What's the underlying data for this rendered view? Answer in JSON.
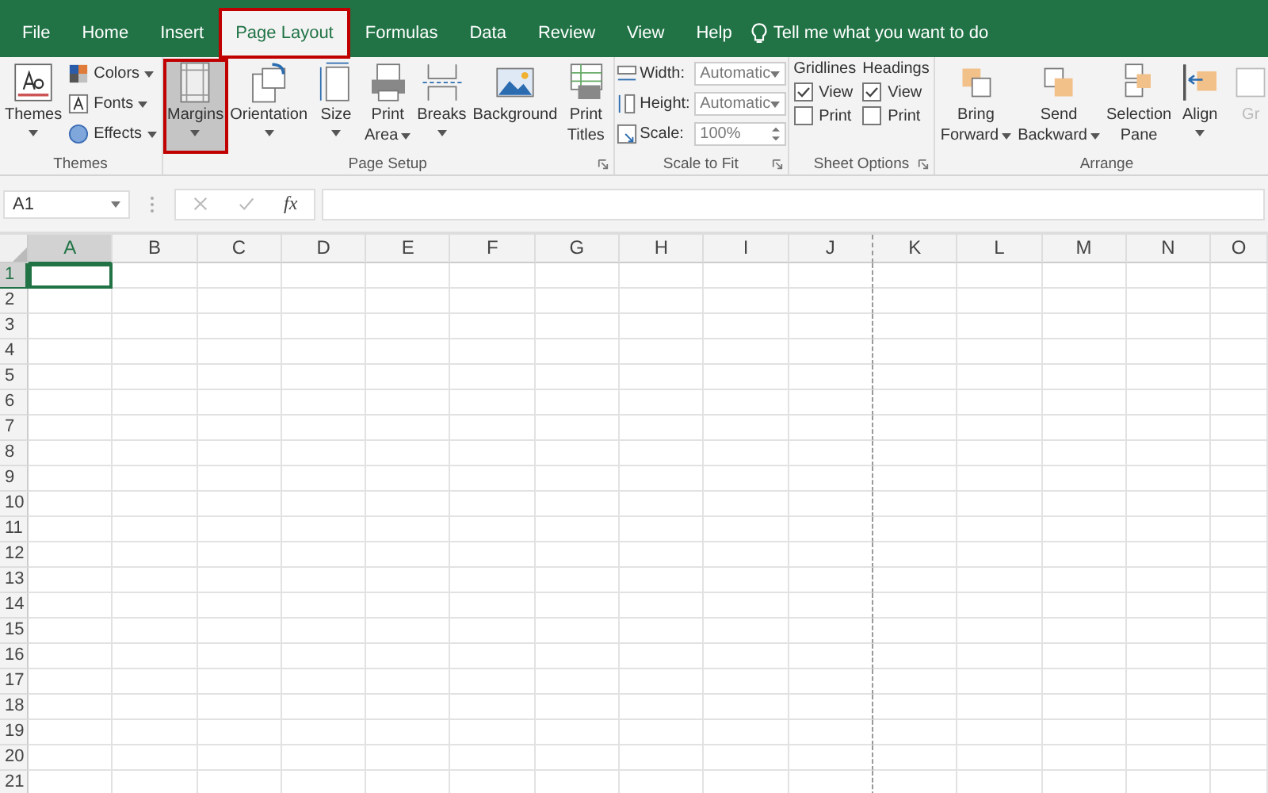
{
  "tabs": [
    {
      "label": "File",
      "selected": false,
      "highlighted": false
    },
    {
      "label": "Home",
      "selected": false,
      "highlighted": false
    },
    {
      "label": "Insert",
      "selected": false,
      "highlighted": false
    },
    {
      "label": "Page Layout",
      "selected": true,
      "highlighted": true
    },
    {
      "label": "Formulas",
      "selected": false,
      "highlighted": false
    },
    {
      "label": "Data",
      "selected": false,
      "highlighted": false
    },
    {
      "label": "Review",
      "selected": false,
      "highlighted": false
    },
    {
      "label": "View",
      "selected": false,
      "highlighted": false
    },
    {
      "label": "Help",
      "selected": false,
      "highlighted": false
    }
  ],
  "tell_me": {
    "placeholder": "Tell me what you want to do"
  },
  "ribbon": [
    {
      "label": "Themes",
      "launcher": false,
      "items": [
        {
          "kind": "large",
          "lines": [
            "Themes"
          ],
          "dropdown": true,
          "highlighted": false,
          "disabled": false
        },
        {
          "kind": "stack",
          "entries": [
            {
              "label": "Colors",
              "dropdown": true
            },
            {
              "label": "Fonts",
              "dropdown": true
            },
            {
              "label": "Effects",
              "dropdown": true
            }
          ]
        }
      ]
    },
    {
      "label": "Page Setup",
      "launcher": true,
      "items": [
        {
          "kind": "large",
          "lines": [
            "Margins"
          ],
          "dropdown": true,
          "highlighted": true,
          "disabled": false
        },
        {
          "kind": "large",
          "lines": [
            "Orientation"
          ],
          "dropdown": true,
          "highlighted": false,
          "disabled": false
        },
        {
          "kind": "large",
          "lines": [
            "Size"
          ],
          "dropdown": true,
          "highlighted": false,
          "disabled": false
        },
        {
          "kind": "large",
          "lines": [
            "Print",
            "Area"
          ],
          "dropdown": true,
          "highlighted": false,
          "disabled": false
        },
        {
          "kind": "large",
          "lines": [
            "Breaks"
          ],
          "dropdown": true,
          "highlighted": false,
          "disabled": false
        },
        {
          "kind": "large",
          "lines": [
            "Background"
          ],
          "dropdown": false,
          "highlighted": false,
          "disabled": false
        },
        {
          "kind": "large",
          "lines": [
            "Print",
            "Titles"
          ],
          "dropdown": false,
          "highlighted": false,
          "disabled": false
        }
      ]
    },
    {
      "label": "Scale to Fit",
      "launcher": true,
      "items": [
        {
          "kind": "fields",
          "entries": [
            {
              "label": "Width:",
              "value": "Automatic"
            },
            {
              "label": "Height:",
              "value": "Automatic"
            },
            {
              "label": "Scale:",
              "value": "100%"
            }
          ]
        }
      ]
    },
    {
      "label": "Sheet Options",
      "launcher": true,
      "items": [
        {
          "kind": "checks",
          "title": "Gridlines",
          "entries": [
            {
              "label": "View",
              "checked": true
            },
            {
              "label": "Print",
              "checked": false
            }
          ]
        },
        {
          "kind": "checks",
          "title": "Headings",
          "entries": [
            {
              "label": "View",
              "checked": true
            },
            {
              "label": "Print",
              "checked": false
            }
          ]
        }
      ]
    },
    {
      "label": "Arrange",
      "launcher": false,
      "items": [
        {
          "kind": "large",
          "lines": [
            "Bring",
            "Forward"
          ],
          "dropdown": true,
          "highlighted": false,
          "disabled": false
        },
        {
          "kind": "large",
          "lines": [
            "Send",
            "Backward"
          ],
          "dropdown": true,
          "highlighted": false,
          "disabled": false
        },
        {
          "kind": "large",
          "lines": [
            "Selection",
            "Pane"
          ],
          "dropdown": false,
          "highlighted": false,
          "disabled": false
        },
        {
          "kind": "large",
          "lines": [
            "Align"
          ],
          "dropdown": true,
          "highlighted": false,
          "disabled": false
        },
        {
          "kind": "large",
          "lines": [
            "Gr"
          ],
          "dropdown": false,
          "highlighted": false,
          "disabled": true
        }
      ]
    }
  ],
  "formula_bar": {
    "name_box": "A1",
    "function_button": "fx"
  },
  "columns": [
    {
      "label": "A",
      "selected": true,
      "page_break_after": false
    },
    {
      "label": "B",
      "selected": false,
      "page_break_after": false
    },
    {
      "label": "C",
      "selected": false,
      "page_break_after": false
    },
    {
      "label": "D",
      "selected": false,
      "page_break_after": false
    },
    {
      "label": "E",
      "selected": false,
      "page_break_after": false
    },
    {
      "label": "F",
      "selected": false,
      "page_break_after": false
    },
    {
      "label": "G",
      "selected": false,
      "page_break_after": false
    },
    {
      "label": "H",
      "selected": false,
      "page_break_after": false
    },
    {
      "label": "I",
      "selected": false,
      "page_break_after": false
    },
    {
      "label": "J",
      "selected": false,
      "page_break_after": true
    },
    {
      "label": "K",
      "selected": false,
      "page_break_after": false
    },
    {
      "label": "L",
      "selected": false,
      "page_break_after": false
    },
    {
      "label": "M",
      "selected": false,
      "page_break_after": false
    },
    {
      "label": "N",
      "selected": false,
      "page_break_after": false
    },
    {
      "label": "O",
      "selected": false,
      "page_break_after": false
    }
  ],
  "rows": [
    {
      "label": "1",
      "selected": true
    },
    {
      "label": "2",
      "selected": false
    },
    {
      "label": "3",
      "selected": false
    },
    {
      "label": "4",
      "selected": false
    },
    {
      "label": "5",
      "selected": false
    },
    {
      "label": "6",
      "selected": false
    },
    {
      "label": "7",
      "selected": false
    },
    {
      "label": "8",
      "selected": false
    },
    {
      "label": "9",
      "selected": false
    },
    {
      "label": "10",
      "selected": false
    },
    {
      "label": "11",
      "selected": false
    },
    {
      "label": "12",
      "selected": false
    },
    {
      "label": "13",
      "selected": false
    },
    {
      "label": "14",
      "selected": false
    },
    {
      "label": "15",
      "selected": false
    },
    {
      "label": "16",
      "selected": false
    },
    {
      "label": "17",
      "selected": false
    },
    {
      "label": "18",
      "selected": false
    },
    {
      "label": "19",
      "selected": false
    },
    {
      "label": "20",
      "selected": false
    },
    {
      "label": "21",
      "selected": false
    }
  ]
}
